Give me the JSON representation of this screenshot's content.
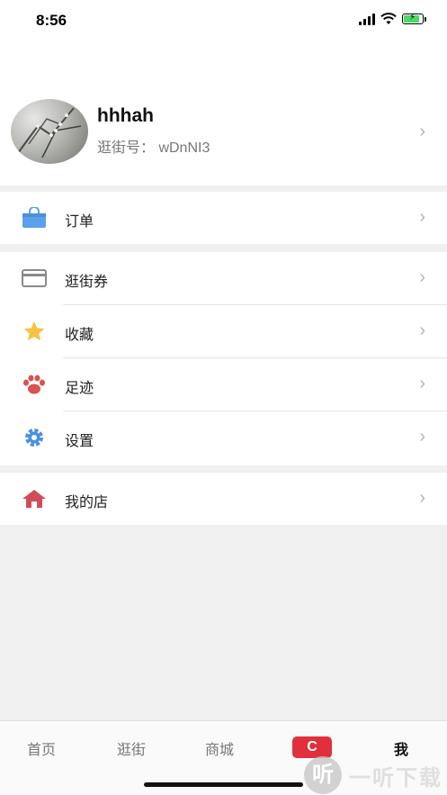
{
  "status_bar": {
    "time": "8:56"
  },
  "profile": {
    "name": "hhhah",
    "id_text": "逛街号： wDnNI3"
  },
  "menu": {
    "orders": {
      "label": "订单",
      "icon": "shopping-bag-icon"
    },
    "coupons": {
      "label": "逛街券",
      "icon": "card-icon"
    },
    "favorites": {
      "label": "收藏",
      "icon": "star-icon"
    },
    "footprints": {
      "label": "足迹",
      "icon": "paw-icon"
    },
    "settings": {
      "label": "设置",
      "icon": "gear-icon"
    },
    "my_store": {
      "label": "我的店",
      "icon": "house-icon"
    }
  },
  "tabs": [
    {
      "label": "首页"
    },
    {
      "label": "逛街"
    },
    {
      "label": "商城"
    },
    {
      "label": "C"
    },
    {
      "label": "我"
    }
  ],
  "watermark": {
    "logo_text": "听",
    "text": "一听下载"
  },
  "colors": {
    "accent_red": "#e0303c",
    "blue_icon": "#4a90e2",
    "star": "#f5c242",
    "paw": "#d9534f",
    "house": "#d14b5a"
  }
}
